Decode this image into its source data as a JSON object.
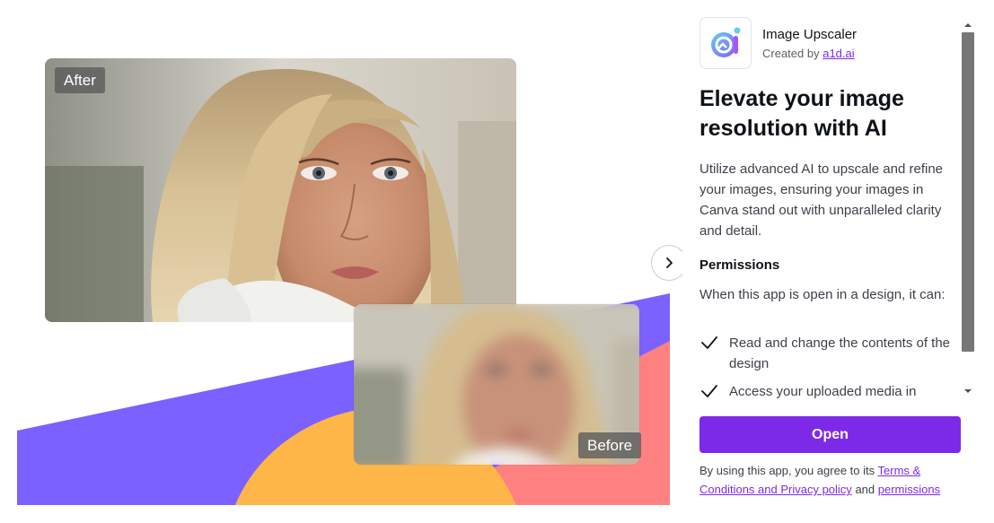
{
  "showcase": {
    "after_label": "After",
    "before_label": "Before",
    "next_icon": "chevron-right-icon",
    "colors": {
      "purple": "#7b61ff",
      "coral": "#ff8080",
      "yellow": "#ffb648"
    }
  },
  "app": {
    "name": "Image Upscaler",
    "created_by_prefix": "Created by",
    "creator": "a1d.ai",
    "icon": "app-logo-icon"
  },
  "headline": "Elevate your image resolution with AI",
  "description": "Utilize advanced AI to upscale and refine your images, ensuring your images in Canva stand out with unparalleled clarity and detail.",
  "permissions": {
    "title": "Permissions",
    "intro": "When this app is open in a design, it can:",
    "items": [
      {
        "icon": "checkmark-icon",
        "text": "Read and change the contents of the design"
      },
      {
        "icon": "checkmark-icon",
        "text": "Access your uploaded media in"
      }
    ]
  },
  "open_button": "Open",
  "legal": {
    "prefix": "By using this app, you agree to its",
    "terms_link": "Terms & Conditions and Privacy policy",
    "and_text": "and",
    "permissions_link": "permissions"
  },
  "accent_color": "#7d2ae8"
}
